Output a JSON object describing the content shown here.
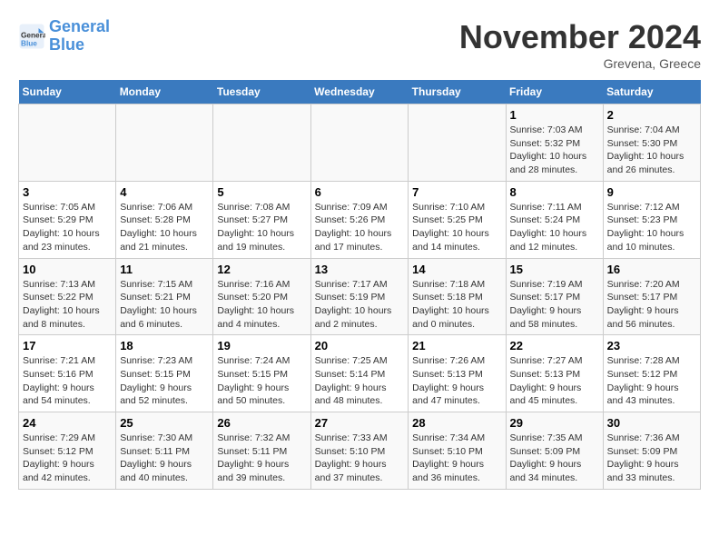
{
  "logo": {
    "text_general": "General",
    "text_blue": "Blue"
  },
  "header": {
    "month": "November 2024",
    "location": "Grevena, Greece"
  },
  "weekdays": [
    "Sunday",
    "Monday",
    "Tuesday",
    "Wednesday",
    "Thursday",
    "Friday",
    "Saturday"
  ],
  "weeks": [
    [
      {
        "day": "",
        "info": ""
      },
      {
        "day": "",
        "info": ""
      },
      {
        "day": "",
        "info": ""
      },
      {
        "day": "",
        "info": ""
      },
      {
        "day": "",
        "info": ""
      },
      {
        "day": "1",
        "info": "Sunrise: 7:03 AM\nSunset: 5:32 PM\nDaylight: 10 hours and 28 minutes."
      },
      {
        "day": "2",
        "info": "Sunrise: 7:04 AM\nSunset: 5:30 PM\nDaylight: 10 hours and 26 minutes."
      }
    ],
    [
      {
        "day": "3",
        "info": "Sunrise: 7:05 AM\nSunset: 5:29 PM\nDaylight: 10 hours and 23 minutes."
      },
      {
        "day": "4",
        "info": "Sunrise: 7:06 AM\nSunset: 5:28 PM\nDaylight: 10 hours and 21 minutes."
      },
      {
        "day": "5",
        "info": "Sunrise: 7:08 AM\nSunset: 5:27 PM\nDaylight: 10 hours and 19 minutes."
      },
      {
        "day": "6",
        "info": "Sunrise: 7:09 AM\nSunset: 5:26 PM\nDaylight: 10 hours and 17 minutes."
      },
      {
        "day": "7",
        "info": "Sunrise: 7:10 AM\nSunset: 5:25 PM\nDaylight: 10 hours and 14 minutes."
      },
      {
        "day": "8",
        "info": "Sunrise: 7:11 AM\nSunset: 5:24 PM\nDaylight: 10 hours and 12 minutes."
      },
      {
        "day": "9",
        "info": "Sunrise: 7:12 AM\nSunset: 5:23 PM\nDaylight: 10 hours and 10 minutes."
      }
    ],
    [
      {
        "day": "10",
        "info": "Sunrise: 7:13 AM\nSunset: 5:22 PM\nDaylight: 10 hours and 8 minutes."
      },
      {
        "day": "11",
        "info": "Sunrise: 7:15 AM\nSunset: 5:21 PM\nDaylight: 10 hours and 6 minutes."
      },
      {
        "day": "12",
        "info": "Sunrise: 7:16 AM\nSunset: 5:20 PM\nDaylight: 10 hours and 4 minutes."
      },
      {
        "day": "13",
        "info": "Sunrise: 7:17 AM\nSunset: 5:19 PM\nDaylight: 10 hours and 2 minutes."
      },
      {
        "day": "14",
        "info": "Sunrise: 7:18 AM\nSunset: 5:18 PM\nDaylight: 10 hours and 0 minutes."
      },
      {
        "day": "15",
        "info": "Sunrise: 7:19 AM\nSunset: 5:17 PM\nDaylight: 9 hours and 58 minutes."
      },
      {
        "day": "16",
        "info": "Sunrise: 7:20 AM\nSunset: 5:17 PM\nDaylight: 9 hours and 56 minutes."
      }
    ],
    [
      {
        "day": "17",
        "info": "Sunrise: 7:21 AM\nSunset: 5:16 PM\nDaylight: 9 hours and 54 minutes."
      },
      {
        "day": "18",
        "info": "Sunrise: 7:23 AM\nSunset: 5:15 PM\nDaylight: 9 hours and 52 minutes."
      },
      {
        "day": "19",
        "info": "Sunrise: 7:24 AM\nSunset: 5:15 PM\nDaylight: 9 hours and 50 minutes."
      },
      {
        "day": "20",
        "info": "Sunrise: 7:25 AM\nSunset: 5:14 PM\nDaylight: 9 hours and 48 minutes."
      },
      {
        "day": "21",
        "info": "Sunrise: 7:26 AM\nSunset: 5:13 PM\nDaylight: 9 hours and 47 minutes."
      },
      {
        "day": "22",
        "info": "Sunrise: 7:27 AM\nSunset: 5:13 PM\nDaylight: 9 hours and 45 minutes."
      },
      {
        "day": "23",
        "info": "Sunrise: 7:28 AM\nSunset: 5:12 PM\nDaylight: 9 hours and 43 minutes."
      }
    ],
    [
      {
        "day": "24",
        "info": "Sunrise: 7:29 AM\nSunset: 5:12 PM\nDaylight: 9 hours and 42 minutes."
      },
      {
        "day": "25",
        "info": "Sunrise: 7:30 AM\nSunset: 5:11 PM\nDaylight: 9 hours and 40 minutes."
      },
      {
        "day": "26",
        "info": "Sunrise: 7:32 AM\nSunset: 5:11 PM\nDaylight: 9 hours and 39 minutes."
      },
      {
        "day": "27",
        "info": "Sunrise: 7:33 AM\nSunset: 5:10 PM\nDaylight: 9 hours and 37 minutes."
      },
      {
        "day": "28",
        "info": "Sunrise: 7:34 AM\nSunset: 5:10 PM\nDaylight: 9 hours and 36 minutes."
      },
      {
        "day": "29",
        "info": "Sunrise: 7:35 AM\nSunset: 5:09 PM\nDaylight: 9 hours and 34 minutes."
      },
      {
        "day": "30",
        "info": "Sunrise: 7:36 AM\nSunset: 5:09 PM\nDaylight: 9 hours and 33 minutes."
      }
    ]
  ]
}
